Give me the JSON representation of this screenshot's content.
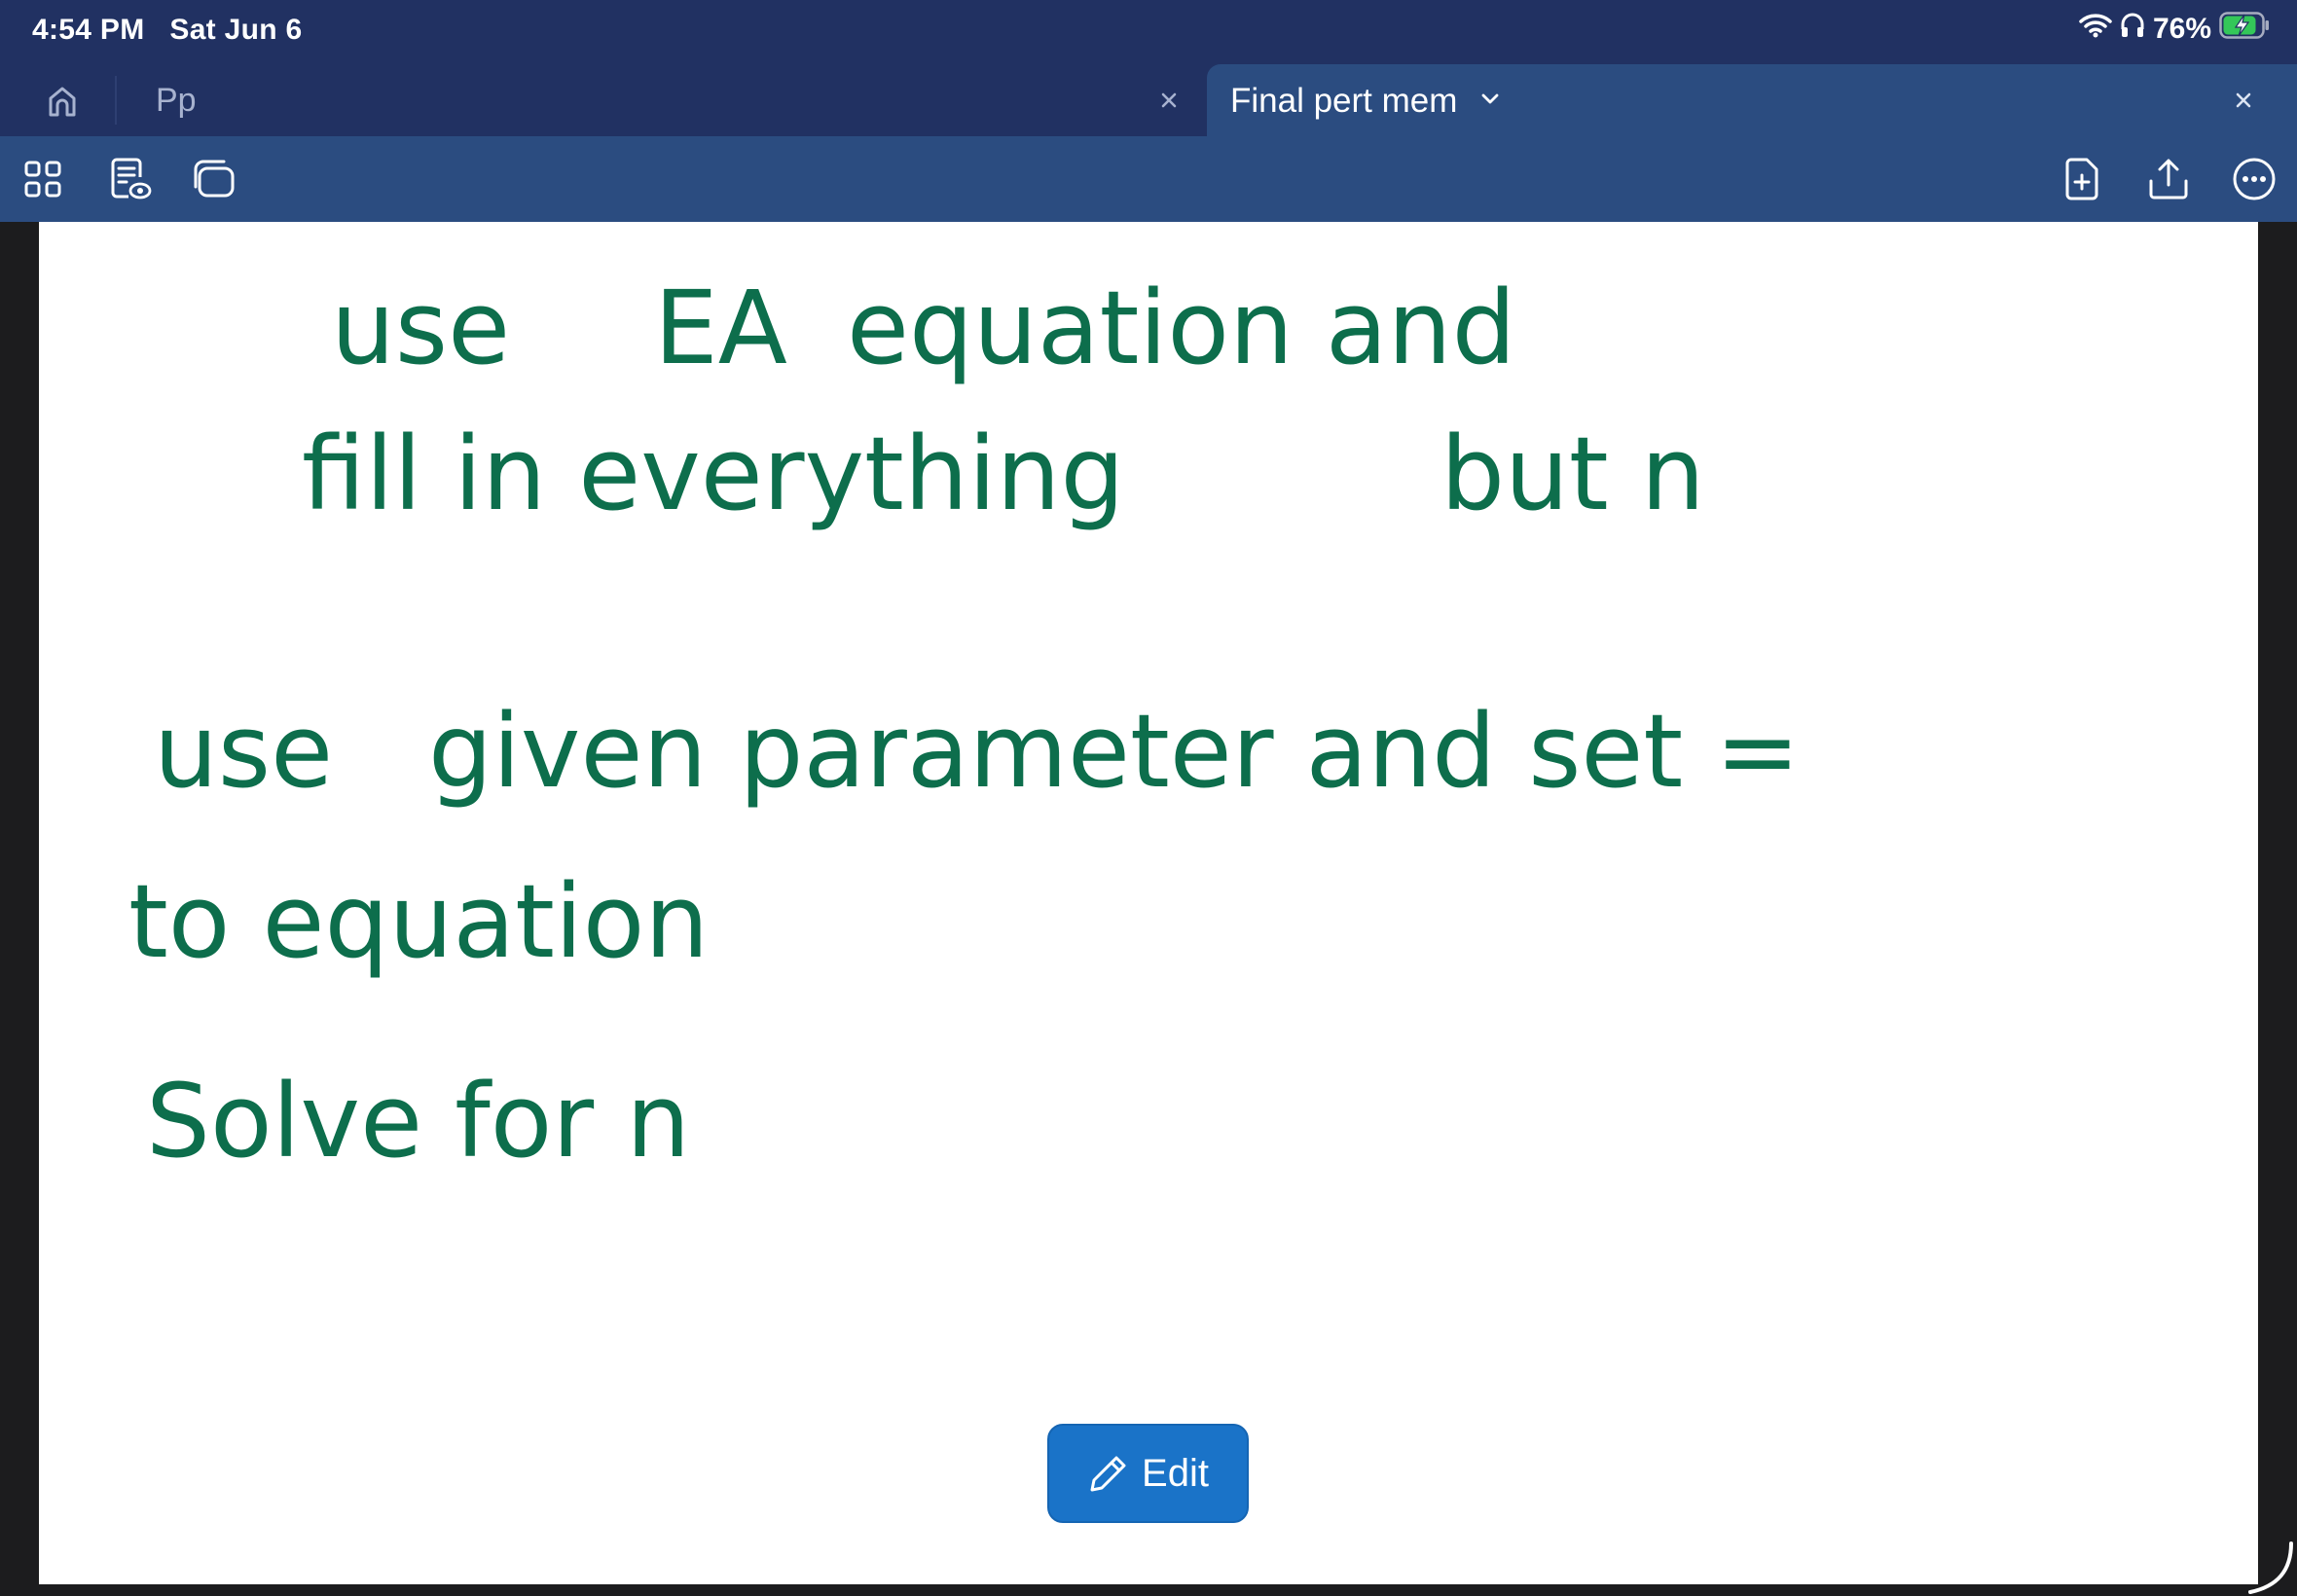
{
  "status_bar": {
    "time": "4:54 PM",
    "date": "Sat Jun 6",
    "battery": "76%",
    "icons": [
      "wifi-icon",
      "headphones-icon",
      "battery-charging-icon"
    ]
  },
  "tabs": [
    {
      "label": "Pp",
      "active": false
    },
    {
      "label": "Final pert mem",
      "active": true
    }
  ],
  "toolbar": {
    "left_icons": [
      "grid-view-icon",
      "document-view-icon",
      "windows-icon"
    ],
    "right_icons": [
      "new-page-icon",
      "share-icon",
      "more-icon"
    ]
  },
  "document": {
    "lines": [
      "use",
      "EA",
      "equation and",
      "fill in everything",
      "but n",
      "use",
      "given parameter and set =",
      "to equation",
      "Solve for n"
    ]
  },
  "edit_button": {
    "label": "Edit"
  },
  "colors": {
    "header": "#213162",
    "toolbar": "#2b4c80",
    "ink": "#0d6e4c",
    "edit_button": "#1a73c8"
  }
}
